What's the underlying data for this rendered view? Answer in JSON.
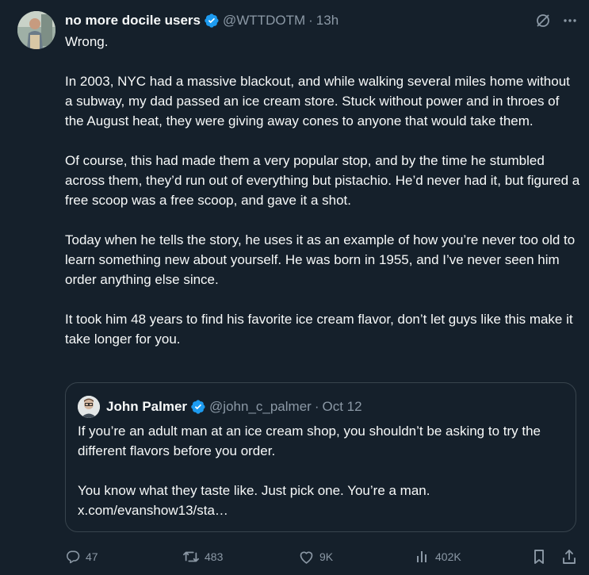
{
  "tweet": {
    "author": {
      "display_name": "no more docile users",
      "handle": "@WTTDOTM",
      "separator": "·",
      "time": "13h",
      "verified": true
    },
    "paragraphs": [
      "Wrong.",
      "In 2003, NYC had a massive blackout, and while walking several miles home without a subway, my dad passed an ice cream store. Stuck without power and in throes of the August heat, they were giving away cones to anyone that would take them.",
      "Of course, this had made them a very popular stop, and by the time he stumbled across them, they’d run out of everything but pistachio. He’d never had it, but figured a free scoop was a free scoop, and gave it a shot.",
      "Today when he tells the story, he uses it as an example of how you’re never too old to learn something new about yourself. He was born in 1955, and I’ve never seen him order anything else since.",
      "It took him 48 years to find his favorite ice cream flavor, don’t let guys like this make it take longer for you."
    ],
    "quote": {
      "display_name": "John Palmer",
      "handle": "@john_c_palmer",
      "separator": "·",
      "date": "Oct 12",
      "verified": true,
      "paragraphs": [
        "If you’re an adult man at an ice cream shop, you shouldn’t be asking to try the different flavors before you order.",
        "You know what they taste like. Just pick one. You’re a man. x.com/evanshow13/sta…"
      ]
    },
    "stats": {
      "replies": "47",
      "reposts": "483",
      "likes": "9K",
      "views": "402K"
    }
  },
  "icons": {
    "verified": "verified-badge-icon",
    "grok": "grok-icon",
    "more": "more-icon",
    "reply": "reply-icon",
    "repost": "repost-icon",
    "like": "like-icon",
    "views": "views-icon",
    "bookmark": "bookmark-icon",
    "share": "share-icon"
  },
  "colors": {
    "background": "#15202b",
    "text": "#f7f9f9",
    "muted": "#8b98a5",
    "border": "#38444d",
    "verified": "#1d9bf0"
  }
}
